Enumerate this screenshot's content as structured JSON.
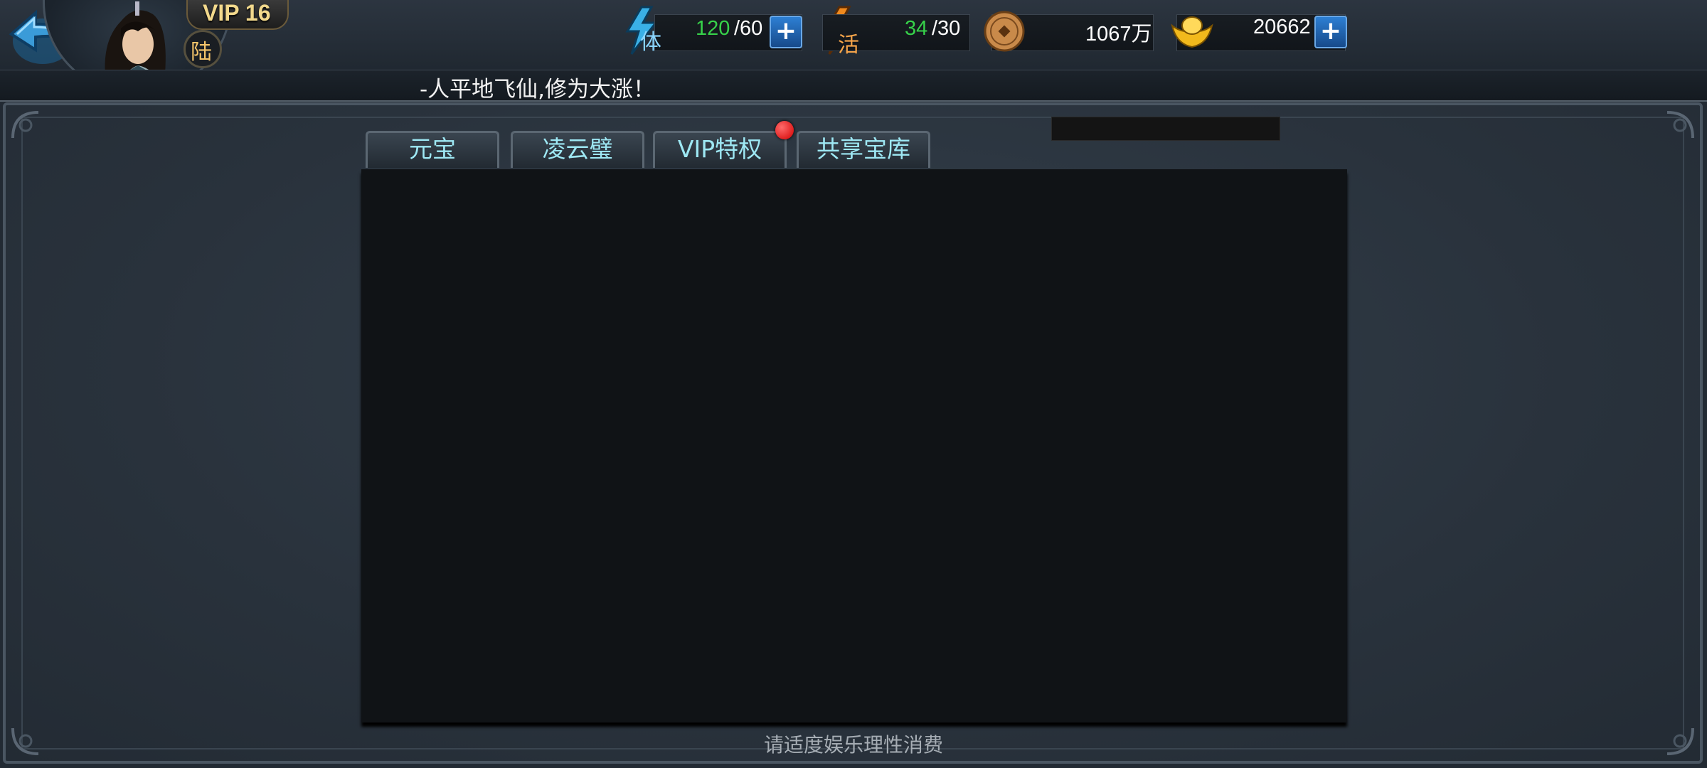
{
  "header": {
    "vip_label": "VIP 16",
    "server_label": "陆",
    "marquee": "-人平地飞仙,修为大涨！"
  },
  "resources": {
    "stamina": {
      "icon_text": "体",
      "current": "120",
      "max": "/60"
    },
    "energy": {
      "icon_text": "活",
      "current": "34",
      "max": "/30"
    },
    "copper": {
      "value": "1067万"
    },
    "gold": {
      "value": "20662"
    }
  },
  "tabs": [
    {
      "label": "元宝"
    },
    {
      "label": "凌云璧"
    },
    {
      "label": "VIP特权",
      "has_red_dot": true
    },
    {
      "label": "共享宝库"
    }
  ],
  "footer": {
    "tip": "请适度娱乐理性消费"
  },
  "colors": {
    "tab_text": "#9ee8f4",
    "green_value": "#37d14a",
    "red_dot": "#d10000",
    "plus_button": "#2d7fd3"
  },
  "icons": [
    "back-arrow-icon",
    "stamina-lightning-icon",
    "energy-lightning-icon",
    "copper-coin-icon",
    "gold-ingot-icon",
    "plus-icon"
  ]
}
